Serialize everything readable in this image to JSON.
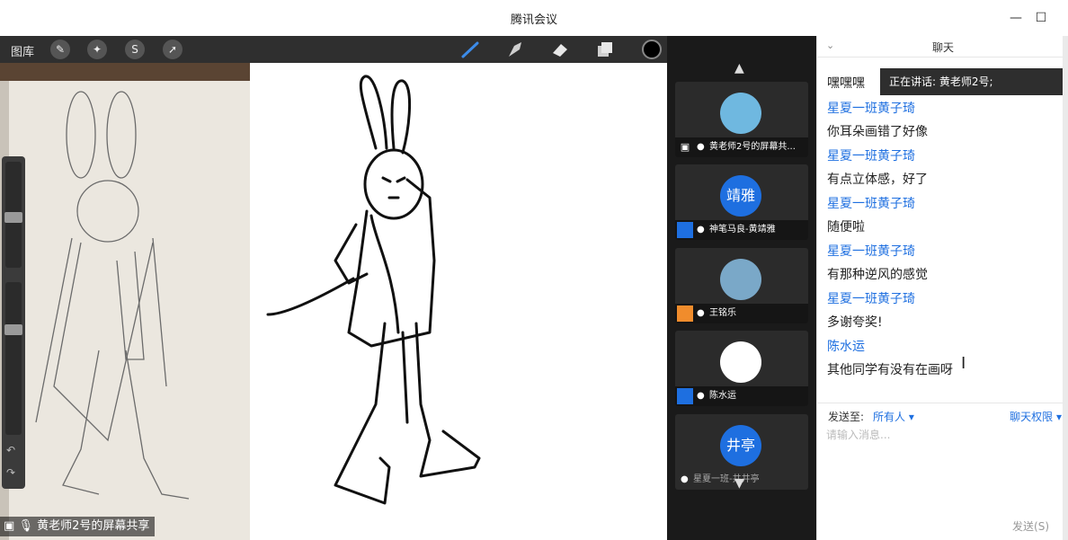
{
  "window": {
    "title": "腾讯会议"
  },
  "toolbar": {
    "gallery_label": "图库"
  },
  "share": {
    "label": "黄老师2号的屏幕共享"
  },
  "participants": [
    {
      "name": "黄老师2号的屏幕共...",
      "avatar_text": "",
      "avatar_color": "#6fb8e0",
      "icon": "screen-share-icon"
    },
    {
      "name": "神笔马良-黄靖雅",
      "avatar_text": "靖雅",
      "avatar_color": "#1e6fe0",
      "icon": "user-icon"
    },
    {
      "name": "王铭乐",
      "avatar_text": "",
      "avatar_color": "#7aa8c8",
      "icon": "user-icon"
    },
    {
      "name": "陈水运",
      "avatar_text": "",
      "avatar_color": "#ffffff",
      "icon": "user-icon"
    },
    {
      "name": "星夏一班-井井亭",
      "avatar_text": "井亭",
      "avatar_color": "#1e6fe0",
      "icon": "user-icon"
    }
  ],
  "chat": {
    "title": "聊天",
    "speaking": "正在讲话: 黄老师2号;",
    "messages": [
      {
        "sender": "星夏一班黄子琦",
        "text": "嘿嘿嘿"
      },
      {
        "sender": "星夏一班黄子琦",
        "text": "你耳朵画错了好像"
      },
      {
        "sender": "星夏一班黄子琦",
        "text": "有点立体感，好了"
      },
      {
        "sender": "星夏一班黄子琦",
        "text": "随便啦"
      },
      {
        "sender": "星夏一班黄子琦",
        "text": "有那种逆风的感觉"
      },
      {
        "sender": "星夏一班黄子琦",
        "text": "多谢夸奖!"
      },
      {
        "sender": "陈水运",
        "text": "其他同学有没有在画呀"
      }
    ],
    "send_to_label": "发送至:",
    "send_to_value": "所有人 ▾",
    "permission_label": "聊天权限 ▾",
    "input_placeholder": "请输入消息...",
    "send_button": "发送(S)"
  },
  "colors": {
    "accent": "#1e6fe0",
    "panel_dark": "#1a1a1a",
    "toolbar_dark": "#2f2f2f"
  }
}
